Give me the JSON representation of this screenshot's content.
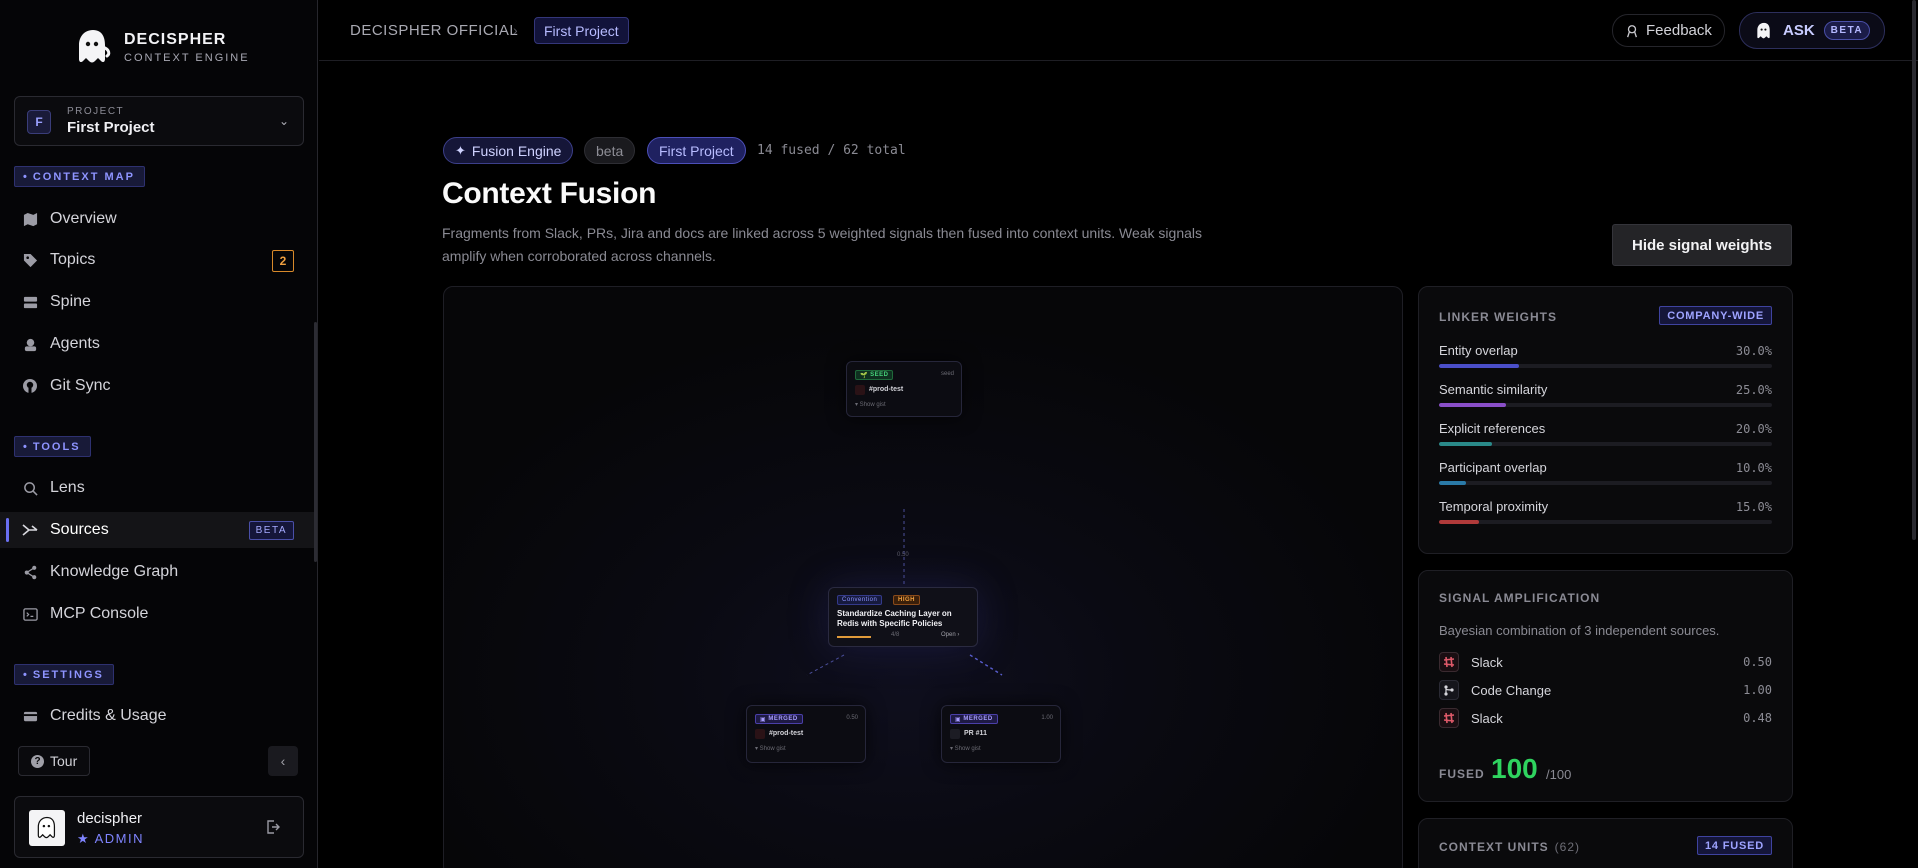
{
  "brand": {
    "name": "DECISPHER",
    "subtitle": "CONTEXT ENGINE"
  },
  "project": {
    "avatar_letter": "F",
    "label": "PROJECT",
    "name": "First Project"
  },
  "sidebar": {
    "sections": [
      {
        "title": "CONTEXT MAP",
        "items": [
          {
            "label": "Overview",
            "icon": "map-icon"
          },
          {
            "label": "Topics",
            "icon": "tag-icon",
            "badge": "2"
          },
          {
            "label": "Spine",
            "icon": "layers-icon"
          },
          {
            "label": "Agents",
            "icon": "agents-icon"
          },
          {
            "label": "Git Sync",
            "icon": "github-icon"
          }
        ]
      },
      {
        "title": "TOOLS",
        "items": [
          {
            "label": "Lens",
            "icon": "search-icon"
          },
          {
            "label": "Sources",
            "icon": "sources-icon",
            "badge": "BETA",
            "active": true
          },
          {
            "label": "Knowledge Graph",
            "icon": "share-icon"
          },
          {
            "label": "MCP Console",
            "icon": "console-icon"
          }
        ]
      },
      {
        "title": "SETTINGS",
        "items": [
          {
            "label": "Credits & Usage",
            "icon": "credit-card-icon"
          }
        ]
      }
    ],
    "tour_label": "Tour",
    "user": {
      "name": "decispher",
      "role": "ADMIN"
    }
  },
  "topbar": {
    "breadcrumb_root": "DECISPHER OFFICIAL",
    "breadcrumb_current": "First Project",
    "feedback_label": "Feedback",
    "ask_label": "ASK",
    "ask_badge": "BETA"
  },
  "main": {
    "chips": {
      "fusion": "Fusion Engine",
      "beta": "beta",
      "project": "First Project"
    },
    "fused_count": "14 fused / 62 total",
    "title": "Context Fusion",
    "description": "Fragments from Slack, PRs, Jira and docs are linked across 5 weighted signals then fused into context units. Weak signals amplify when corroborated across channels.",
    "hide_weights_label": "Hide signal weights"
  },
  "graph": {
    "seed": {
      "tag": "SEED",
      "meta": "seed",
      "channel": "#prod-test",
      "gist": "▾ Show gist"
    },
    "center": {
      "type": "Convention",
      "priority": "HIGH",
      "title": "Standardize Caching Layer on Redis with Specific Policies",
      "meta": "4/8",
      "open": "Open ›"
    },
    "merged_left": {
      "tag": "MERGED",
      "meta": "0.50",
      "channel": "#prod-test",
      "gist": "▾ Show gist"
    },
    "merged_right": {
      "tag": "MERGED",
      "meta": "1.00",
      "channel": "PR #11",
      "gist": "▾ Show gist"
    },
    "edge_label": "0.50"
  },
  "linker_weights": {
    "title": "LINKER WEIGHTS",
    "badge": "COMPANY-WIDE",
    "items": [
      {
        "label": "Entity overlap",
        "value": "30.0%",
        "fraction": 0.3,
        "color": "#4b4fc9"
      },
      {
        "label": "Semantic similarity",
        "value": "25.0%",
        "fraction": 0.25,
        "color": "#8a4fc9"
      },
      {
        "label": "Explicit references",
        "value": "20.0%",
        "fraction": 0.2,
        "color": "#2a8a8a"
      },
      {
        "label": "Participant overlap",
        "value": "10.0%",
        "fraction": 0.1,
        "color": "#2a7aa8"
      },
      {
        "label": "Temporal proximity",
        "value": "15.0%",
        "fraction": 0.15,
        "color": "#b03a3a"
      }
    ]
  },
  "signal_amplification": {
    "title": "SIGNAL AMPLIFICATION",
    "description": "Bayesian combination of 3 independent sources.",
    "sources": [
      {
        "name": "Slack",
        "value": "0.50",
        "icon": "slack-icon"
      },
      {
        "name": "Code Change",
        "value": "1.00",
        "icon": "code-change-icon"
      },
      {
        "name": "Slack",
        "value": "0.48",
        "icon": "slack-icon"
      }
    ],
    "fused_label": "FUSED",
    "fused_value": "100",
    "fused_max": "/100"
  },
  "context_units": {
    "title": "CONTEXT UNITS",
    "count": "(62)",
    "badge": "14 FUSED"
  }
}
